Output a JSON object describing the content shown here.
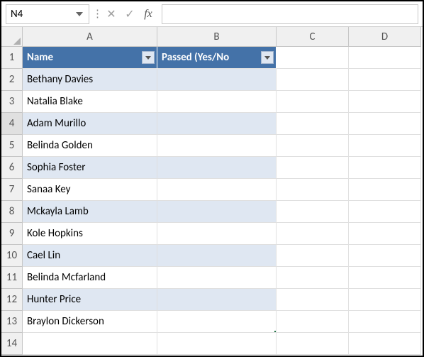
{
  "nameBox": {
    "value": "N4"
  },
  "formula": {
    "value": ""
  },
  "columns": [
    "A",
    "B",
    "C",
    "D"
  ],
  "headerRow": {
    "A": "Name",
    "B": "Passed (Yes/No"
  },
  "rows": [
    {
      "n": "1"
    },
    {
      "n": "2",
      "A": "Bethany Davies"
    },
    {
      "n": "3",
      "A": "Natalia Blake"
    },
    {
      "n": "4",
      "A": "Adam Murillo"
    },
    {
      "n": "5",
      "A": "Belinda Golden"
    },
    {
      "n": "6",
      "A": "Sophia Foster"
    },
    {
      "n": "7",
      "A": "Sanaa Key"
    },
    {
      "n": "8",
      "A": "Mckayla Lamb"
    },
    {
      "n": "9",
      "A": "Kole Hopkins"
    },
    {
      "n": "10",
      "A": "Cael Lin"
    },
    {
      "n": "11",
      "A": "Belinda Mcfarland"
    },
    {
      "n": "12",
      "A": "Hunter Price"
    },
    {
      "n": "13",
      "A": "Braylon Dickerson"
    },
    {
      "n": "14"
    }
  ]
}
